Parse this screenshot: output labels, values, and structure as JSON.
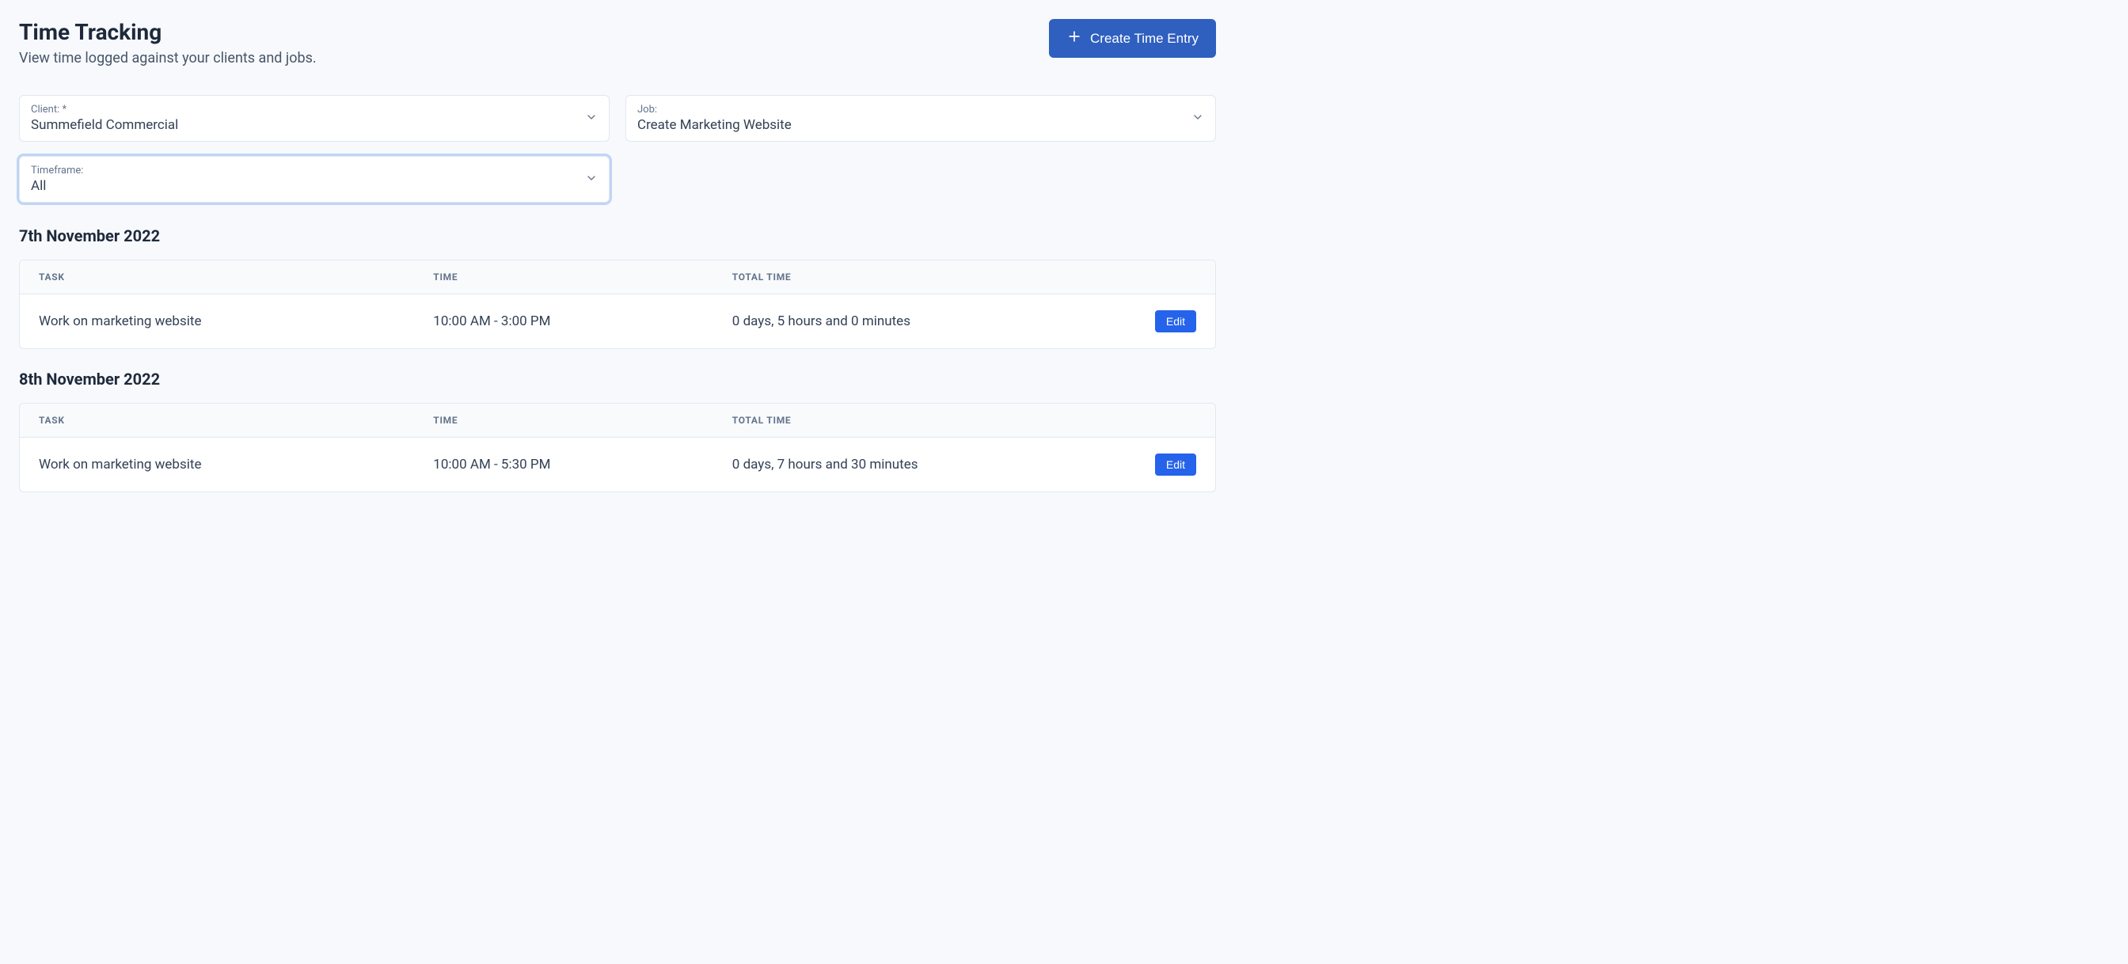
{
  "header": {
    "title": "Time Tracking",
    "subtitle": "View time logged against your clients and jobs.",
    "create_btn": "Create Time Entry"
  },
  "filters": {
    "client": {
      "label": "Client: *",
      "value": "Summefield Commercial"
    },
    "job": {
      "label": "Job:",
      "value": "Create Marketing Website"
    },
    "timeframe": {
      "label": "Timeframe:",
      "value": "All",
      "focused": true
    }
  },
  "columns": {
    "task": "Task",
    "time": "Time",
    "total": "Total Time",
    "action": ""
  },
  "actions": {
    "edit": "Edit"
  },
  "days": [
    {
      "heading": "7th November 2022",
      "rows": [
        {
          "task": "Work on marketing website",
          "time": "10:00 AM - 3:00 PM",
          "total": "0 days, 5 hours and 0 minutes"
        }
      ]
    },
    {
      "heading": "8th November 2022",
      "rows": [
        {
          "task": "Work on marketing website",
          "time": "10:00 AM - 5:30 PM",
          "total": "0 days, 7 hours and 30 minutes"
        }
      ]
    }
  ]
}
